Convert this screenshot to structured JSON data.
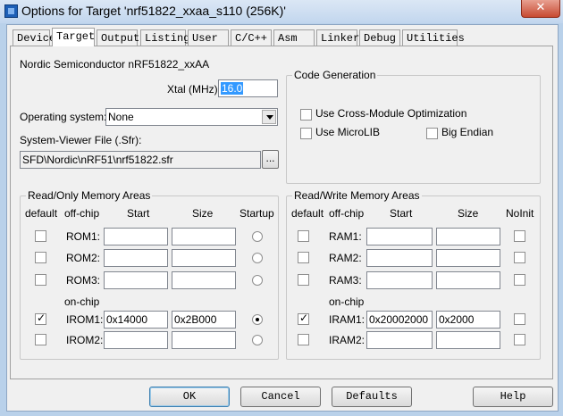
{
  "window": {
    "title": "Options for Target 'nrf51822_xxaa_s110 (256K)'",
    "close_glyph": "✕",
    "app_icon": "keil-uvision-icon"
  },
  "tabs": [
    "Device",
    "Target",
    "Output",
    "Listing",
    "User",
    "C/C++",
    "Asm",
    "Linker",
    "Debug",
    "Utilities"
  ],
  "active_tab": "Target",
  "device_name": "Nordic Semiconductor nRF51822_xxAA",
  "xtal": {
    "label": "Xtal (MHz):",
    "value": "16.0"
  },
  "os": {
    "label": "Operating system:",
    "value": "None"
  },
  "sfr": {
    "label": "System-Viewer File (.Sfr):",
    "value": "SFD\\Nordic\\nRF51\\nrf51822.sfr",
    "browse_label": "..."
  },
  "code_gen": {
    "title": "Code Generation",
    "cross_module": {
      "label": "Use Cross-Module Optimization",
      "checked": false
    },
    "microlib": {
      "label": "Use MicroLIB",
      "checked": false
    },
    "big_endian": {
      "label": "Big Endian",
      "checked": false
    }
  },
  "rom": {
    "title": "Read/Only Memory Areas",
    "headers": {
      "default": "default",
      "offchip": "off-chip",
      "start": "Start",
      "size": "Size",
      "startup": "Startup"
    },
    "onchip_label": "on-chip",
    "rows": [
      {
        "name": "ROM1:",
        "default": false,
        "start": "",
        "size": "",
        "startup": false
      },
      {
        "name": "ROM2:",
        "default": false,
        "start": "",
        "size": "",
        "startup": false
      },
      {
        "name": "ROM3:",
        "default": false,
        "start": "",
        "size": "",
        "startup": false
      },
      {
        "name": "IROM1:",
        "default": true,
        "start": "0x14000",
        "size": "0x2B000",
        "startup": true
      },
      {
        "name": "IROM2:",
        "default": false,
        "start": "",
        "size": "",
        "startup": false
      }
    ]
  },
  "ram": {
    "title": "Read/Write Memory Areas",
    "headers": {
      "default": "default",
      "offchip": "off-chip",
      "start": "Start",
      "size": "Size",
      "noinit": "NoInit"
    },
    "onchip_label": "on-chip",
    "rows": [
      {
        "name": "RAM1:",
        "default": false,
        "start": "",
        "size": "",
        "noinit": false
      },
      {
        "name": "RAM2:",
        "default": false,
        "start": "",
        "size": "",
        "noinit": false
      },
      {
        "name": "RAM3:",
        "default": false,
        "start": "",
        "size": "",
        "noinit": false
      },
      {
        "name": "IRAM1:",
        "default": true,
        "start": "0x20002000",
        "size": "0x2000",
        "noinit": false
      },
      {
        "name": "IRAM2:",
        "default": false,
        "start": "",
        "size": "",
        "noinit": false
      }
    ]
  },
  "buttons": {
    "ok": "OK",
    "cancel": "Cancel",
    "defaults": "Defaults",
    "help": "Help"
  }
}
